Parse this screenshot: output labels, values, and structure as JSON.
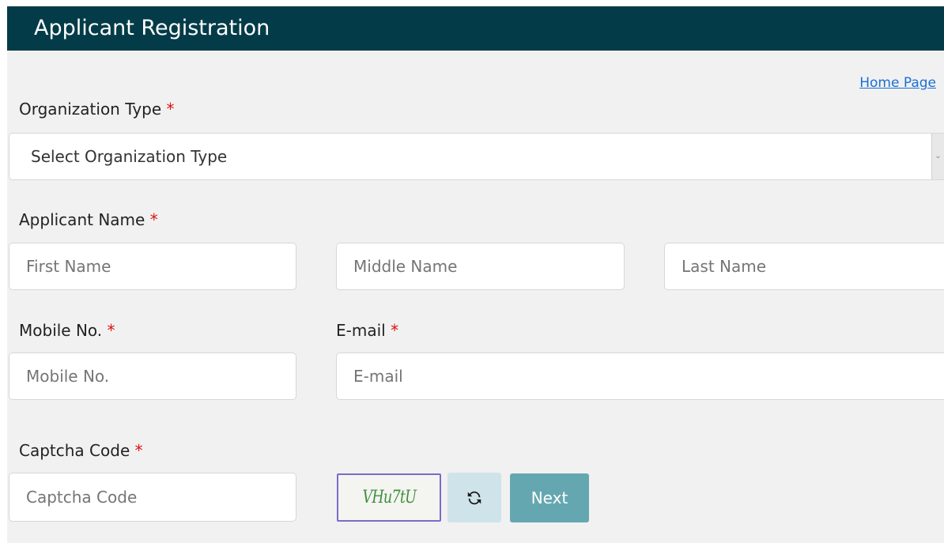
{
  "header": {
    "title": "Applicant Registration"
  },
  "nav": {
    "home_link": "Home Page"
  },
  "org_type": {
    "label": "Organization Type",
    "required_marker": "*",
    "selected": "Select Organization Type"
  },
  "applicant_name": {
    "label": "Applicant Name",
    "required_marker": "*",
    "first_placeholder": "First Name",
    "middle_placeholder": "Middle Name",
    "last_placeholder": "Last Name"
  },
  "mobile": {
    "label": "Mobile No.",
    "required_marker": "*",
    "placeholder": "Mobile No."
  },
  "email": {
    "label": "E-mail",
    "required_marker": "*",
    "placeholder": "E-mail"
  },
  "captcha": {
    "label": "Captcha Code",
    "required_marker": "*",
    "placeholder": "Captcha Code",
    "image_text": "VHu7tU"
  },
  "buttons": {
    "next_label": "Next"
  },
  "icons": {
    "refresh": "refresh-icon",
    "dropdown": "chevron-down-icon"
  },
  "colors": {
    "header_bg": "#033c48",
    "required": "#e01010",
    "next_button": "#65a7b1",
    "refresh_button": "#cfe3ea",
    "link": "#1a6fd4"
  }
}
